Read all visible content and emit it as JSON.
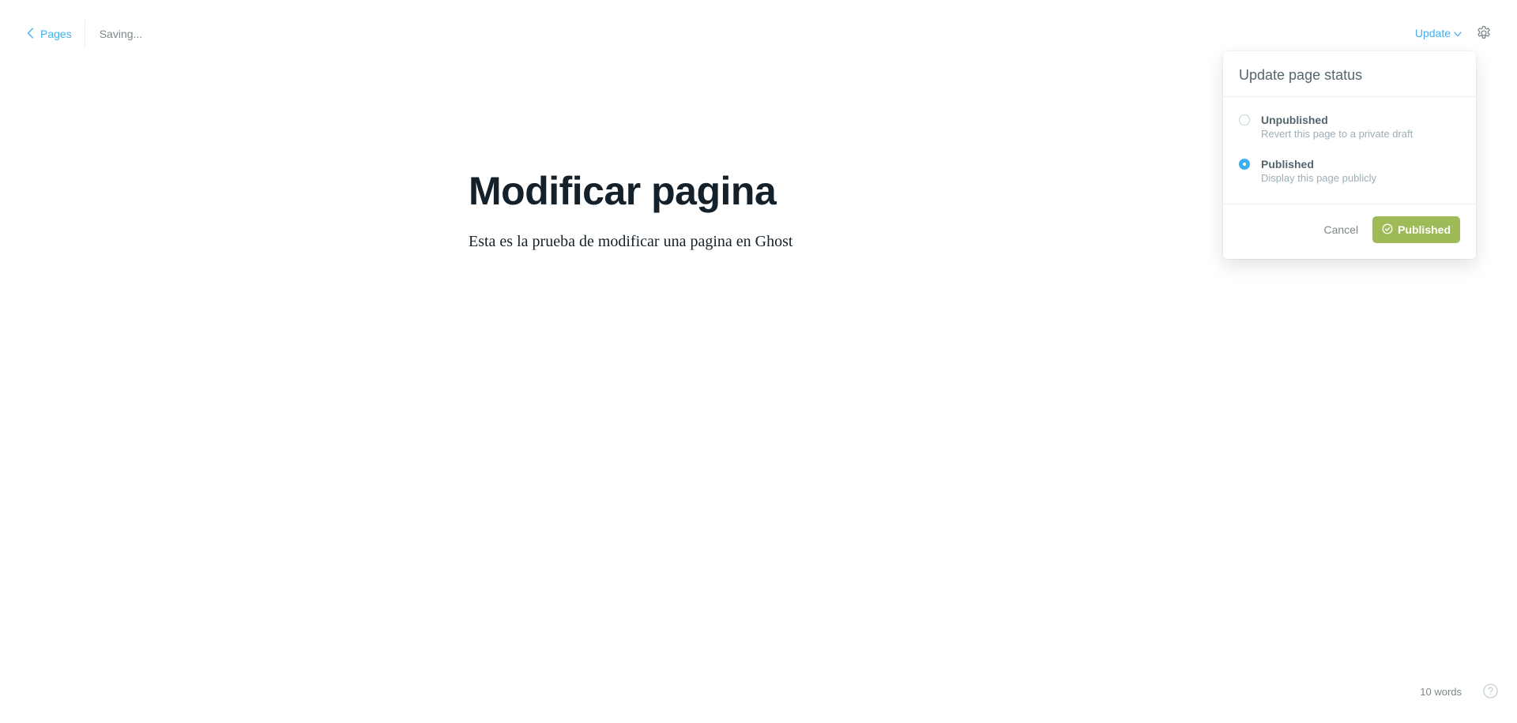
{
  "header": {
    "back_label": "Pages",
    "status_text": "Saving...",
    "update_label": "Update"
  },
  "editor": {
    "title": "Modificar pagina",
    "body": "Esta es la prueba de modificar una pagina en Ghost"
  },
  "publish_menu": {
    "title": "Update page status",
    "options": [
      {
        "label": "Unpublished",
        "description": "Revert this page to a private draft",
        "selected": false
      },
      {
        "label": "Published",
        "description": "Display this page publicly",
        "selected": true
      }
    ],
    "cancel_label": "Cancel",
    "confirm_label": "Published"
  },
  "footer": {
    "word_count": "10 words"
  },
  "colors": {
    "accent": "#3eb0ef",
    "published_button": "#9fbb58",
    "text_dark": "#15212a",
    "text_muted": "#7d878a"
  },
  "icons": [
    "chevron-left-icon",
    "chevron-down-icon",
    "gear-icon",
    "check-circle-icon",
    "help-icon"
  ]
}
